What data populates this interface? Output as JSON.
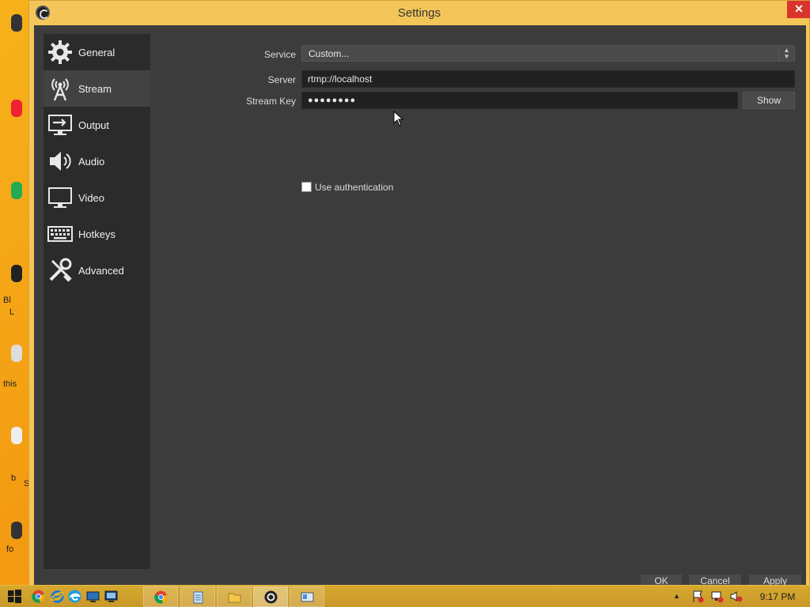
{
  "window": {
    "title": "Settings",
    "close_glyph": "✕"
  },
  "desktop_fragments": [
    "Bl",
    "L",
    "this",
    "b",
    "S",
    "fo"
  ],
  "sidebar": {
    "items": [
      {
        "label": "General",
        "icon": "gear-icon"
      },
      {
        "label": "Stream",
        "icon": "antenna-icon",
        "active": true
      },
      {
        "label": "Output",
        "icon": "output-monitor-icon"
      },
      {
        "label": "Audio",
        "icon": "speaker-icon"
      },
      {
        "label": "Video",
        "icon": "monitor-icon"
      },
      {
        "label": "Hotkeys",
        "icon": "keyboard-icon"
      },
      {
        "label": "Advanced",
        "icon": "tools-icon"
      }
    ]
  },
  "stream": {
    "service_label": "Service",
    "service_value": "Custom...",
    "server_label": "Server",
    "server_value": "rtmp://localhost",
    "stream_key_label": "Stream Key",
    "stream_key_value": "●●●●●●●●",
    "show_button": "Show",
    "use_auth_label": "Use authentication",
    "use_auth_checked": false
  },
  "footer": {
    "ok": "OK",
    "cancel": "Cancel",
    "apply": "Apply"
  },
  "taskbar": {
    "time": "9:17 PM"
  },
  "colors": {
    "panel": "#3c3c3c",
    "sidebar": "#2b2b2b",
    "titlebar": "#f4c65a",
    "close": "#d9342b"
  }
}
